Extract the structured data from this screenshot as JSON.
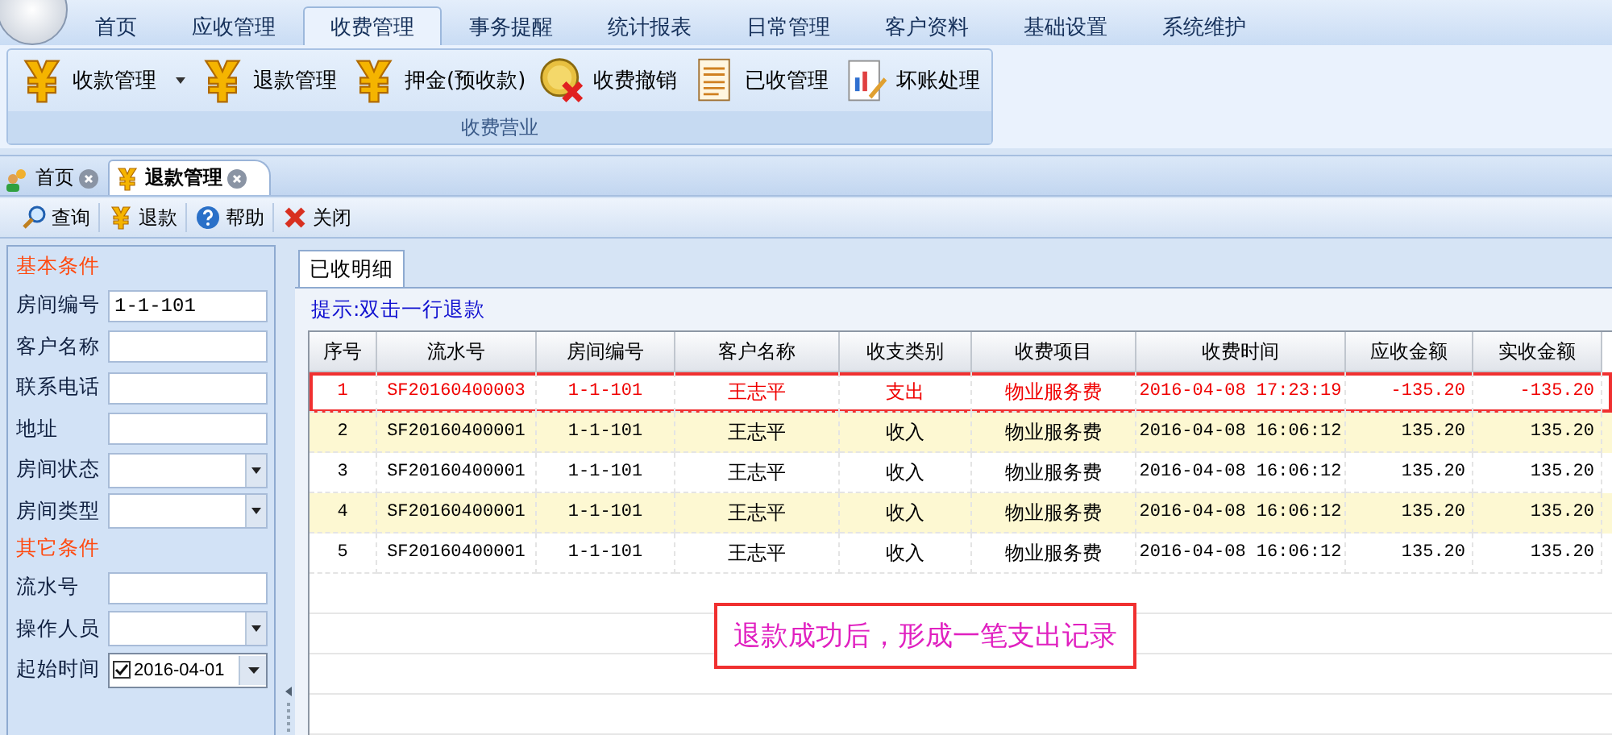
{
  "menu": [
    {
      "label": "首页",
      "selected": false
    },
    {
      "label": "应收管理",
      "selected": false
    },
    {
      "label": "收费管理",
      "selected": true
    },
    {
      "label": "事务提醒",
      "selected": false
    },
    {
      "label": "统计报表",
      "selected": false
    },
    {
      "label": "日常管理",
      "selected": false
    },
    {
      "label": "客户资料",
      "selected": false
    },
    {
      "label": "基础设置",
      "selected": false
    },
    {
      "label": "系统维护",
      "selected": false
    }
  ],
  "ribbon": {
    "buttons": [
      {
        "label": "收款管理",
        "dropdown": true
      },
      {
        "label": "退款管理",
        "dropdown": false
      },
      {
        "label": "押金(预收款)",
        "dropdown": false
      },
      {
        "label": "收费撤销",
        "dropdown": false
      },
      {
        "label": "已收管理",
        "dropdown": false
      },
      {
        "label": "坏账处理",
        "dropdown": false
      }
    ],
    "group_label": "收费营业"
  },
  "doc_tabs": [
    {
      "label": "首页",
      "selected": false
    },
    {
      "label": "退款管理",
      "selected": true
    }
  ],
  "toolbar": [
    "查询",
    "退款",
    "帮助",
    "关闭"
  ],
  "filter": [
    {
      "title": "基本条件",
      "fields": [
        {
          "label": "房间编号",
          "kind": "text",
          "value": "1-1-101"
        },
        {
          "label": "客户名称",
          "kind": "text"
        },
        {
          "label": "联系电话",
          "kind": "text"
        },
        {
          "label": "地址",
          "kind": "text"
        },
        {
          "label": "房间状态",
          "kind": "select"
        },
        {
          "label": "房间类型",
          "kind": "select"
        }
      ]
    },
    {
      "title": "其它条件",
      "fields": [
        {
          "label": "流水号",
          "kind": "text"
        },
        {
          "label": "操作人员",
          "kind": "select"
        },
        {
          "label": "起始时间",
          "kind": "date",
          "value": "2016-04-01",
          "checked": true
        }
      ]
    }
  ],
  "detail": {
    "tab": "已收明细",
    "hint": "提示:双击一行退款",
    "columns": [
      "序号",
      "流水号",
      "房间编号",
      "客户名称",
      "收支类别",
      "收费项目",
      "收费时间",
      "应收金额",
      "实收金额"
    ],
    "rows": [
      {
        "kind": "expense",
        "cells": [
          "1",
          "SF20160400003",
          "1-1-101",
          "王志平",
          "支出",
          "物业服务费",
          "2016-04-08 17:23:19",
          "-135.20",
          "-135.20"
        ]
      },
      {
        "kind": "income",
        "cells": [
          "2",
          "SF20160400001",
          "1-1-101",
          "王志平",
          "收入",
          "物业服务费",
          "2016-04-08 16:06:12",
          "135.20",
          "135.20"
        ]
      },
      {
        "kind": "income",
        "cells": [
          "3",
          "SF20160400001",
          "1-1-101",
          "王志平",
          "收入",
          "物业服务费",
          "2016-04-08 16:06:12",
          "135.20",
          "135.20"
        ]
      },
      {
        "kind": "income",
        "cells": [
          "4",
          "SF20160400001",
          "1-1-101",
          "王志平",
          "收入",
          "物业服务费",
          "2016-04-08 16:06:12",
          "135.20",
          "135.20"
        ]
      },
      {
        "kind": "income",
        "cells": [
          "5",
          "SF20160400001",
          "1-1-101",
          "王志平",
          "收入",
          "物业服务费",
          "2016-04-08 16:06:12",
          "135.20",
          "135.20"
        ]
      }
    ],
    "annotation": "退款成功后，形成一笔支出记录"
  }
}
